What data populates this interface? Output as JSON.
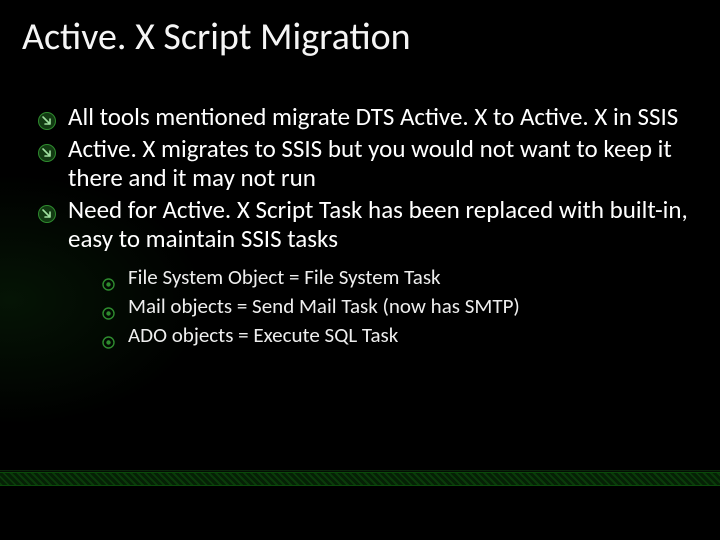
{
  "title": "Active. X Script Migration",
  "bullets": [
    "All tools mentioned migrate DTS Active. X to Active. X in SSIS",
    "Active. X migrates to SSIS but you would not want to keep it there and it may not run",
    "Need for Active. X Script Task has been replaced with built-in, easy to maintain SSIS tasks"
  ],
  "sub_bullets": [
    "File System Object = File System Task",
    "Mail objects = Send Mail Task (now has SMTP)",
    "ADO objects = Execute SQL Task"
  ],
  "colors": {
    "accent": "#2e8b2e",
    "accent_dark": "#0a3a0a"
  }
}
